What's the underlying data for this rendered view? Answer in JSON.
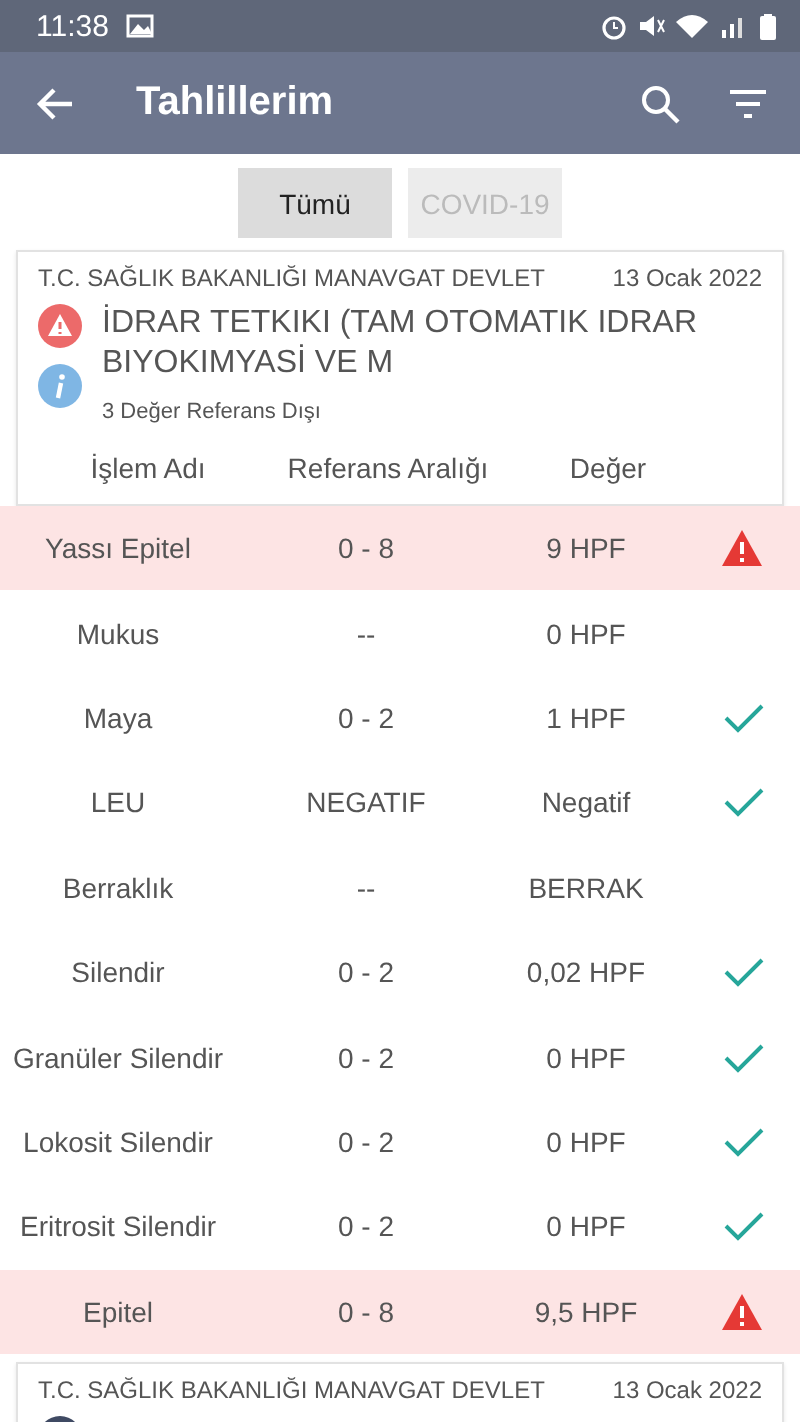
{
  "status_bar": {
    "time": "11:38"
  },
  "app_bar": {
    "title": "Tahlillerim"
  },
  "tabs": [
    {
      "label": "Tümü",
      "selected": true
    },
    {
      "label": "COVID-19",
      "selected": false
    }
  ],
  "cards": [
    {
      "institution": "T.C. SAĞLIK BAKANLIĞI MANAVGAT DEVLET",
      "date": "13 Ocak 2022",
      "title": "İDRAR TETKIKI (TAM OTOMATIK IDRAR BIYOKIMYASİ VE M",
      "summary": "3 Değer Referans Dışı",
      "columns": [
        "İşlem Adı",
        "Referans Aralığı",
        "Değer"
      ],
      "rows": [
        {
          "name": "Yassı Epitel",
          "range": "0 - 8",
          "value": "9 HPF",
          "kind": "alert"
        },
        {
          "name": "Mukus",
          "range": "--",
          "value": "0 HPF",
          "kind": "plain"
        },
        {
          "name": "Maya",
          "range": "0 - 2",
          "value": "1 HPF",
          "kind": "ok"
        },
        {
          "name": "LEU",
          "range": "NEGATIF",
          "value": "Negatif",
          "kind": "ok"
        },
        {
          "name": "Berraklık",
          "range": "--",
          "value": "BERRAK",
          "kind": "plain"
        },
        {
          "name": "Silendir",
          "range": "0 - 2",
          "value": "0,02 HPF",
          "kind": "ok"
        },
        {
          "name": "Granüler Silendir",
          "range": "0 - 2",
          "value": "0 HPF",
          "kind": "ok"
        },
        {
          "name": "Lokosit Silendir",
          "range": "0 - 2",
          "value": "0 HPF",
          "kind": "ok"
        },
        {
          "name": "Eritrosit Silendir",
          "range": "0 - 2",
          "value": "0 HPF",
          "kind": "ok"
        },
        {
          "name": "Epitel",
          "range": "0 - 8",
          "value": "9,5 HPF",
          "kind": "alert"
        }
      ]
    },
    {
      "institution": "T.C. SAĞLIK BAKANLIĞI MANAVGAT DEVLET",
      "date": "13 Ocak 2022"
    }
  ]
}
